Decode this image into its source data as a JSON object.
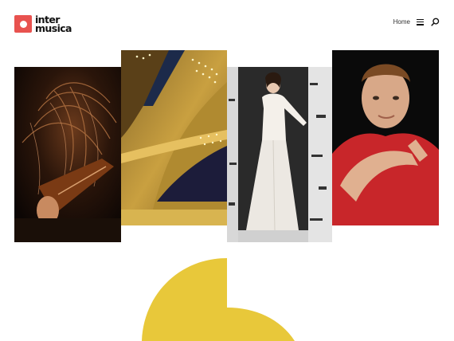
{
  "brand": {
    "name_line1": "inter",
    "name_line2": "musica",
    "accent_color": "#e8524f"
  },
  "nav": {
    "home_label": "Home",
    "menu_icon": "hamburger-menu-icon",
    "search_icon": "search-icon"
  },
  "hero": {
    "photos": [
      {
        "subject": "violinist-photo"
      },
      {
        "subject": "concert-hall-photo"
      },
      {
        "subject": "singer-in-white-dress-photo"
      },
      {
        "subject": "conductor-in-red-shirt-photo"
      }
    ],
    "shape_color": "#e8c83a",
    "caption_fragment": "..."
  }
}
